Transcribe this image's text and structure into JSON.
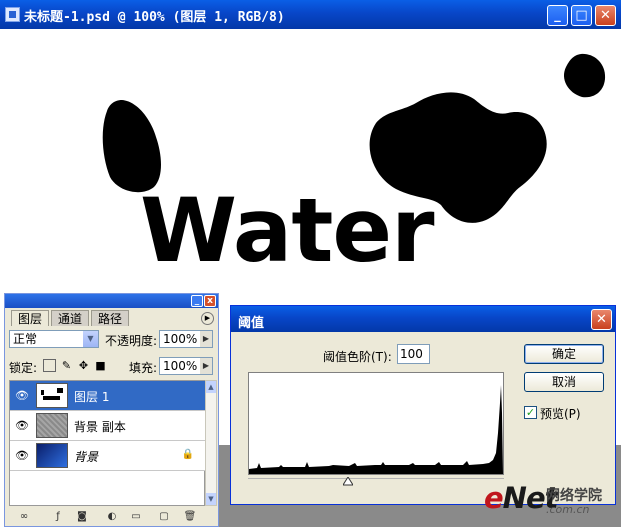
{
  "doc_window": {
    "title": "未标题-1.psd @ 100% (图层 1, RGB/8)",
    "buttons": {
      "minimize": "_",
      "maximize": "□",
      "close": "✕"
    },
    "canvas_text": "Water"
  },
  "layers_panel": {
    "tabs": [
      {
        "label": "图层",
        "active": true
      },
      {
        "label": "通道",
        "active": false
      },
      {
        "label": "路径",
        "active": false
      }
    ],
    "blend_mode": "正常",
    "opacity_label": "不透明度:",
    "opacity_value": "100%",
    "lock_label": "锁定:",
    "fill_label": "填充:",
    "fill_value": "100%",
    "layers": [
      {
        "name": "图层 1",
        "selected": true,
        "visible": true,
        "thumb": "layer1-thumb"
      },
      {
        "name": "背景 副本",
        "selected": false,
        "visible": true,
        "thumb": "texture-thumb"
      },
      {
        "name": "背景",
        "selected": false,
        "visible": true,
        "locked": true,
        "italic": true,
        "thumb": "blue-thumb"
      }
    ]
  },
  "threshold_dialog": {
    "title": "阈值",
    "level_label": "阈值色阶(T):",
    "level_value": "100",
    "ok_label": "确定",
    "cancel_label": "取消",
    "preview_label": "预览(P)",
    "preview_checked": true,
    "slider_value": 100
  },
  "watermark": {
    "brand": "eNet",
    "chinese": "网络学院",
    "domain": ".com.cn"
  },
  "colors": {
    "titlebar": "#0846c8",
    "selection": "#316ac5",
    "panel_bg": "#ece9d8",
    "close_button": "#c9401e"
  }
}
